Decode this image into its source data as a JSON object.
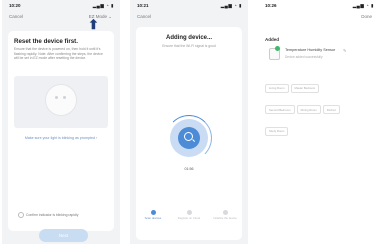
{
  "screen1": {
    "time": "10:20",
    "status_icons": "▂▄▆ ◔ ▮",
    "cancel": "Cancel",
    "mode": "EZ Mode ⌄",
    "title": "Reset the device first.",
    "description": "Ensure that the device is powered on, then hold it until it's flashing rapidly. Note: After confirming the steps, the device will be set in EZ mode after resetting the device.",
    "link": "Make sure your light is blinking as prompted ›",
    "confirm": "Confirm indicator is blinking rapidly",
    "next": "Next"
  },
  "screen2": {
    "time": "10:21",
    "status_icons": "▂▄▆ ◔ ▮",
    "cancel": "Cancel",
    "title": "Adding device...",
    "subtitle": "Ensure that the Wi-Fi signal is good",
    "timer": "01:56",
    "steps": [
      "Scan devices",
      "Register on Cloud",
      "Initialize the device"
    ]
  },
  "screen3": {
    "time": "10:26",
    "status_icons": "▂▄▆ ◔ ▮",
    "done": "Done",
    "added_label": "Added",
    "device_name": "Temperature Humidity Sensor",
    "device_status": "Device added successfully",
    "rooms": [
      "Living Room",
      "Master Bedroom",
      "Second Bedroom",
      "Dining Room",
      "Kitchen",
      "Study Room"
    ]
  },
  "colors": {
    "accent": "#4c8bd6",
    "button_disabled": "#c8dcf2",
    "success": "#3cba6a"
  }
}
